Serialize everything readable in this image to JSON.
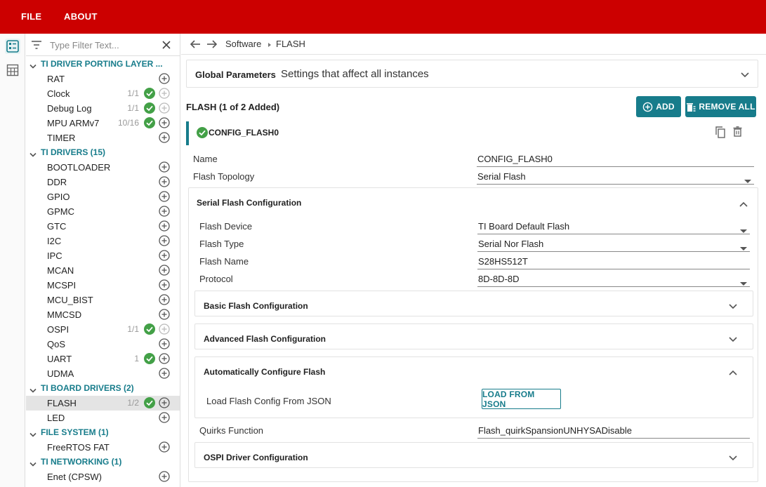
{
  "menu": {
    "file": "FILE",
    "about": "ABOUT"
  },
  "filter": {
    "placeholder": "Type Filter Text..."
  },
  "tree": {
    "categories": [
      {
        "label": "TI DRIVER PORTING LAYER ...",
        "items": [
          {
            "label": "RAT",
            "count": "",
            "added": false,
            "plus_enabled": true
          },
          {
            "label": "Clock",
            "count": "1/1",
            "added": true,
            "plus_enabled": false
          },
          {
            "label": "Debug Log",
            "count": "1/1",
            "added": true,
            "plus_enabled": false
          },
          {
            "label": "MPU ARMv7",
            "count": "10/16",
            "added": true,
            "plus_enabled": true
          },
          {
            "label": "TIMER",
            "count": "",
            "added": false,
            "plus_enabled": true
          }
        ]
      },
      {
        "label": "TI DRIVERS (15)",
        "items": [
          {
            "label": "BOOTLOADER",
            "count": "",
            "added": false,
            "plus_enabled": true
          },
          {
            "label": "DDR",
            "count": "",
            "added": false,
            "plus_enabled": true
          },
          {
            "label": "GPIO",
            "count": "",
            "added": false,
            "plus_enabled": true
          },
          {
            "label": "GPMC",
            "count": "",
            "added": false,
            "plus_enabled": true
          },
          {
            "label": "GTC",
            "count": "",
            "added": false,
            "plus_enabled": true
          },
          {
            "label": "I2C",
            "count": "",
            "added": false,
            "plus_enabled": true
          },
          {
            "label": "IPC",
            "count": "",
            "added": false,
            "plus_enabled": true
          },
          {
            "label": "MCAN",
            "count": "",
            "added": false,
            "plus_enabled": true
          },
          {
            "label": "MCSPI",
            "count": "",
            "added": false,
            "plus_enabled": true
          },
          {
            "label": "MCU_BIST",
            "count": "",
            "added": false,
            "plus_enabled": true
          },
          {
            "label": "MMCSD",
            "count": "",
            "added": false,
            "plus_enabled": true
          },
          {
            "label": "OSPI",
            "count": "1/1",
            "added": true,
            "plus_enabled": false
          },
          {
            "label": "QoS",
            "count": "",
            "added": false,
            "plus_enabled": true
          },
          {
            "label": "UART",
            "count": "1",
            "added": true,
            "plus_enabled": true
          },
          {
            "label": "UDMA",
            "count": "",
            "added": false,
            "plus_enabled": true
          }
        ]
      },
      {
        "label": "TI BOARD DRIVERS (2)",
        "items": [
          {
            "label": "FLASH",
            "count": "1/2",
            "added": true,
            "plus_enabled": true,
            "selected": true
          },
          {
            "label": "LED",
            "count": "",
            "added": false,
            "plus_enabled": true
          }
        ]
      },
      {
        "label": "FILE SYSTEM (1)",
        "items": [
          {
            "label": "FreeRTOS FAT",
            "count": "",
            "added": false,
            "plus_enabled": true
          }
        ]
      },
      {
        "label": "TI NETWORKING (1)",
        "items": [
          {
            "label": "Enet (CPSW)",
            "count": "",
            "added": false,
            "plus_enabled": true
          }
        ]
      }
    ]
  },
  "breadcrumb": {
    "parent": "Software",
    "current": "FLASH"
  },
  "global": {
    "title": "Global Parameters",
    "description": "Settings that affect all instances"
  },
  "module": {
    "heading": "FLASH (1 of 2 Added)",
    "add_label": "ADD",
    "remove_all_label": "REMOVE ALL",
    "instance_name": "CONFIG_FLASH0"
  },
  "fields": {
    "name": {
      "label": "Name",
      "value": "CONFIG_FLASH0"
    },
    "topology": {
      "label": "Flash Topology",
      "value": "Serial Flash"
    }
  },
  "serial": {
    "title": "Serial Flash Configuration",
    "device": {
      "label": "Flash Device",
      "value": "TI Board Default Flash"
    },
    "type": {
      "label": "Flash Type",
      "value": "Serial Nor Flash"
    },
    "fname": {
      "label": "Flash Name",
      "value": "S28HS512T"
    },
    "protocol": {
      "label": "Protocol",
      "value": "8D-8D-8D"
    },
    "basic_title": "Basic Flash Configuration",
    "advanced_title": "Advanced Flash Configuration",
    "auto_title": "Automatically Configure Flash",
    "load_label": "Load Flash Config From JSON",
    "load_button": "LOAD FROM JSON",
    "quirks": {
      "label": "Quirks Function",
      "value": "Flash_quirkSpansionUNHYSADisable"
    },
    "ospi_title": "OSPI Driver Configuration"
  },
  "colors": {
    "topbar": "#cc0000",
    "accent": "#177c8b",
    "success": "#43a047"
  }
}
